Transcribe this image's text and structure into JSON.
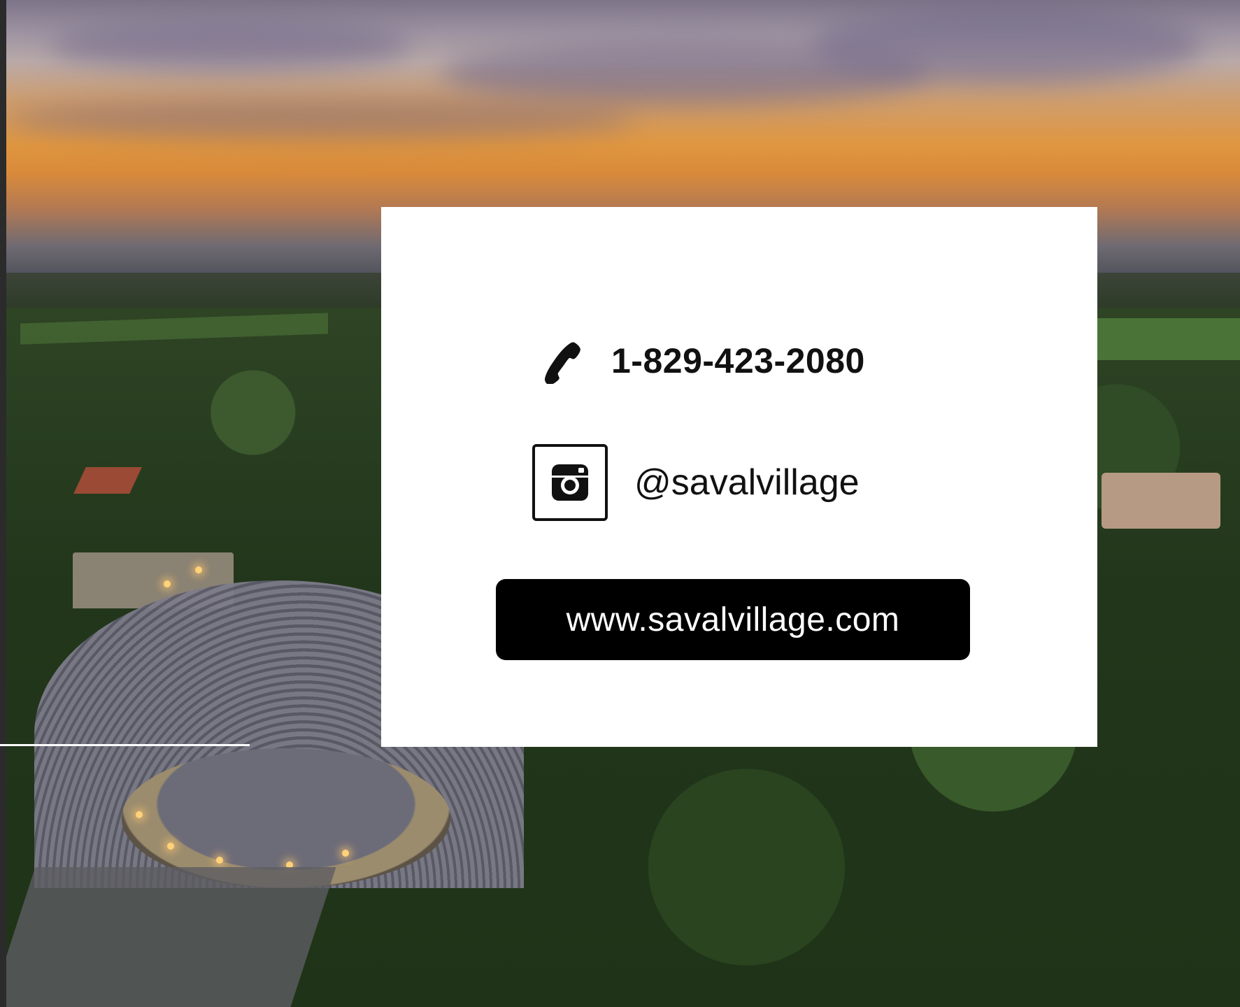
{
  "contact_card": {
    "phone": {
      "icon": "phone-icon",
      "number": "1-829-423-2080"
    },
    "instagram": {
      "icon": "instagram-icon",
      "handle": "@savalvillage"
    },
    "website": {
      "label": "www.savalvillage.com"
    }
  },
  "background": {
    "description_icon": "aerial-photo",
    "accent_colors": {
      "card": "#ffffff",
      "button": "#000000",
      "text": "#111111"
    }
  }
}
